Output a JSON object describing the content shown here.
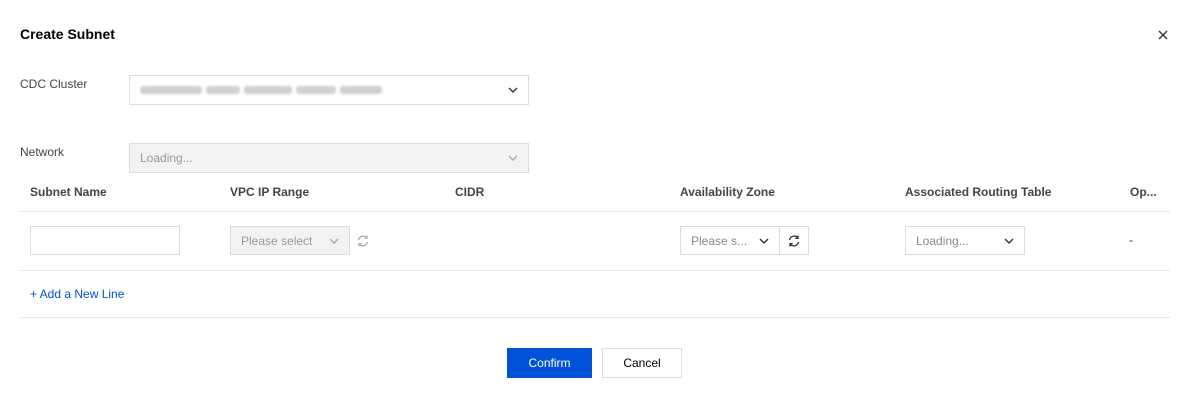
{
  "dialog": {
    "title": "Create Subnet"
  },
  "form": {
    "cdc_cluster_label": "CDC Cluster",
    "network_label": "Network",
    "network_value": "Loading..."
  },
  "table": {
    "headers": [
      "Subnet Name",
      "VPC IP Range",
      "CIDR",
      "Availability Zone",
      "Associated Routing Table",
      "Op..."
    ],
    "row": {
      "subnet_name": "",
      "vpc_ip_range_placeholder": "Please select",
      "availability_zone_placeholder": "Please s...",
      "routing_table_value": "Loading...",
      "operation": "-"
    },
    "add_line": "+ Add a New Line"
  },
  "footer": {
    "confirm": "Confirm",
    "cancel": "Cancel"
  },
  "colors": {
    "primary": "#0052d9",
    "border": "#dcdcdc",
    "disabled_bg": "#f2f2f2"
  }
}
